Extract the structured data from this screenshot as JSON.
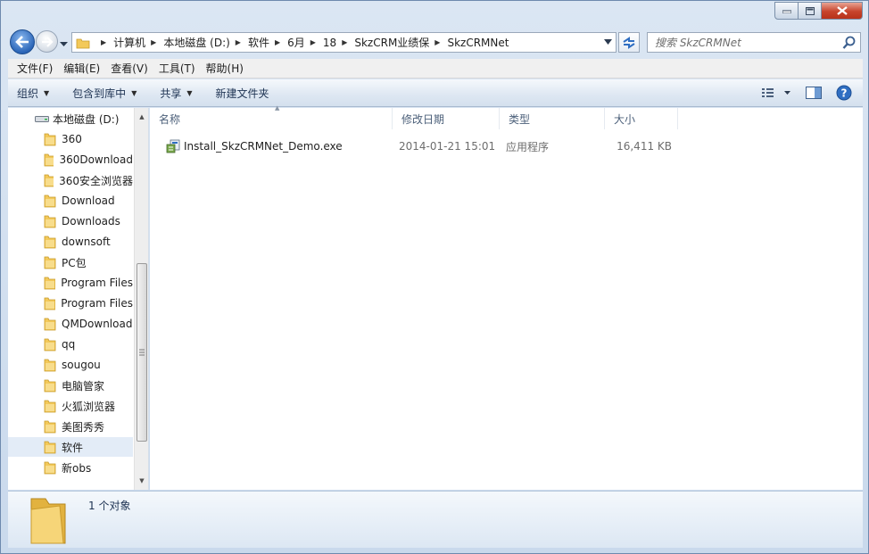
{
  "address": {
    "crumbs": [
      "计算机",
      "本地磁盘 (D:)",
      "软件",
      "6月",
      "18",
      "SkzCRM业绩保",
      "SkzCRMNet"
    ]
  },
  "search": {
    "placeholder": "搜索 SkzCRMNet"
  },
  "menu": [
    {
      "label": "文件(F)"
    },
    {
      "label": "编辑(E)"
    },
    {
      "label": "查看(V)"
    },
    {
      "label": "工具(T)"
    },
    {
      "label": "帮助(H)"
    }
  ],
  "commands": [
    {
      "label": "组织"
    },
    {
      "label": "包含到库中"
    },
    {
      "label": "共享"
    },
    {
      "label": "新建文件夹"
    }
  ],
  "tree": {
    "drive": "本地磁盘 (D:)",
    "folders": [
      "360",
      "360Download",
      "360安全浏览器",
      "Download",
      "Downloads",
      "downsoft",
      "PC包",
      "Program Files",
      "Program Files",
      "QMDownload",
      "qq",
      "sougou",
      "电脑管家",
      "火狐浏览器",
      "美图秀秀",
      "软件",
      "新obs"
    ],
    "selected": "软件"
  },
  "columns": {
    "name": "名称",
    "date": "修改日期",
    "type": "类型",
    "size": "大小"
  },
  "files": [
    {
      "name": "Install_SkzCRMNet_Demo.exe",
      "date": "2014-01-21 15:01",
      "type": "应用程序",
      "size": "16,411 KB"
    }
  ],
  "details": {
    "count": "1 个对象"
  },
  "colors": {
    "accent": "#2c66b8",
    "folder": "#f3c95a",
    "close": "#c7432b"
  }
}
